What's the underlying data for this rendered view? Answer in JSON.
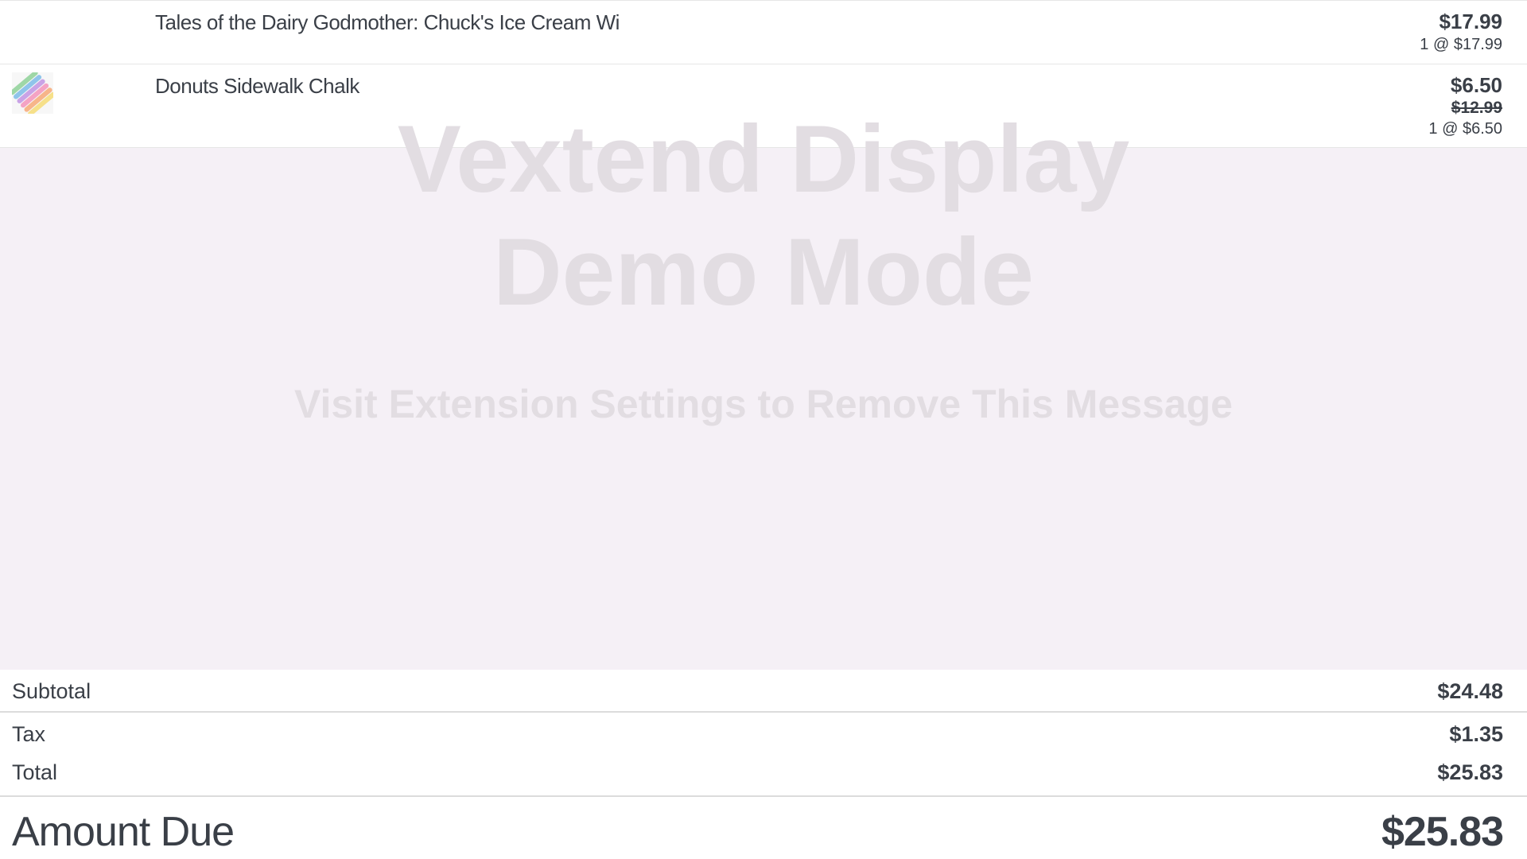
{
  "line_items": [
    {
      "name": "Tales of the Dairy Godmother: Chuck's Ice Cream Wi",
      "price": "$17.99",
      "quantity_line": "1 @ $17.99"
    },
    {
      "name": "Donuts Sidewalk Chalk",
      "price": "$6.50",
      "original_price": "$12.99",
      "quantity_line": "1 @ $6.50",
      "thumbnail_icon": "sidewalk-chalk-thumbnail"
    }
  ],
  "watermark": {
    "line1": "Vextend Display",
    "line2": "Demo Mode",
    "subtitle": "Visit Extension Settings to Remove This Message"
  },
  "totals": {
    "subtotal_label": "Subtotal",
    "subtotal_value": "$24.48",
    "tax_label": "Tax",
    "tax_value": "$1.35",
    "total_label": "Total",
    "total_value": "$25.83",
    "amount_due_label": "Amount Due",
    "amount_due_value": "$25.83"
  },
  "colors": {
    "text": "#3a3f47",
    "background": "#f5f0f6",
    "watermark": "#e2dde2"
  }
}
